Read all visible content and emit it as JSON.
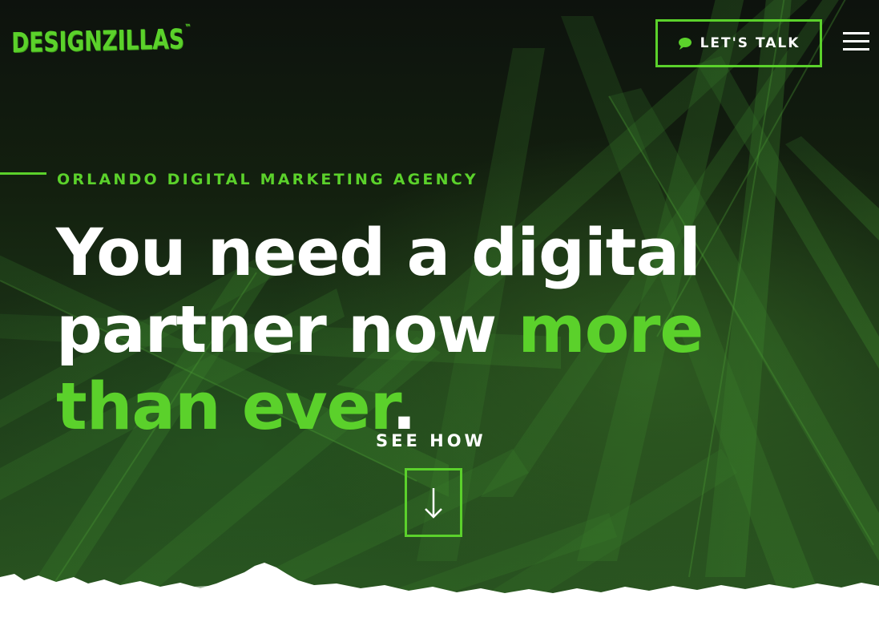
{
  "brand": {
    "logo_text": "DESIGNZILLAS",
    "logo_mark": "™",
    "accent_color": "#5bd12b"
  },
  "header": {
    "cta_label": "LET'S TALK",
    "cta_icon": "chat-bubble-icon",
    "menu_icon": "hamburger-menu-icon"
  },
  "hero": {
    "eyebrow": "ORLANDO DIGITAL MARKETING AGENCY",
    "headline_part1": "You need a digital partner now ",
    "headline_highlight": "more than ever",
    "headline_end": ".",
    "see_how_label": "SEE HOW",
    "scroll_icon": "arrow-down-icon"
  }
}
